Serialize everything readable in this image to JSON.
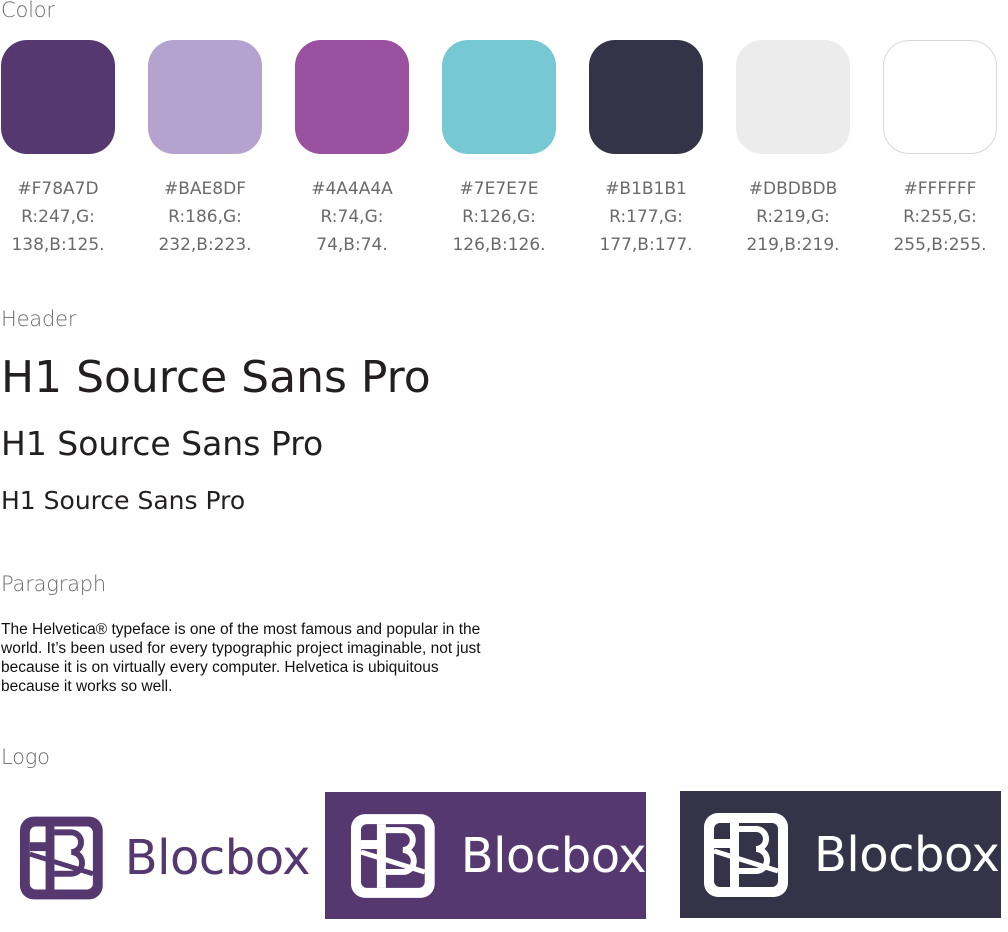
{
  "sections": {
    "color": "Color",
    "header": "Header",
    "paragraph": "Paragraph",
    "logo": "Logo"
  },
  "swatches": [
    {
      "fill": "#54386f",
      "hex": "#F78A7D",
      "rgb1": "R:247,G:",
      "rgb2": "138,B:125."
    },
    {
      "fill": "#b3a3ce",
      "hex": "#BAE8DF",
      "rgb1": "R:186,G:",
      "rgb2": "232,B:223."
    },
    {
      "fill": "#9a52a0",
      "hex": "#4A4A4A",
      "rgb1": "R:74,G:",
      "rgb2": "74,B:74."
    },
    {
      "fill": "#76c8d3",
      "hex": "#7E7E7E",
      "rgb1": "R:126,G:",
      "rgb2": "126,B:126."
    },
    {
      "fill": "#343348",
      "hex": "#B1B1B1",
      "rgb1": "R:177,G:",
      "rgb2": "177,B:177."
    },
    {
      "fill": "#ececec",
      "hex": "#DBDBDB",
      "rgb1": "R:219,G:",
      "rgb2": "219,B:219."
    },
    {
      "fill": "#ffffff",
      "hex": "#FFFFFF",
      "rgb1": "R:255,G:",
      "rgb2": "255,B:255."
    }
  ],
  "headers": {
    "h1": "H1 Source Sans Pro",
    "h2": "H1 Source Sans Pro",
    "h3": "H1 Source Sans Pro"
  },
  "paragraph_text": "The Helvetica® typeface is one of the most famous and popular in the world. It’s been used for every typographic project imaginable, not just because it is on virtually every computer. Helvetica is ubiquitous because it works so well.",
  "logos": [
    {
      "word": "Blocbox",
      "background": "#ffffff",
      "color": "#54386f"
    },
    {
      "word": "Blocbox",
      "background": "#54386f",
      "color": "#ffffff"
    },
    {
      "word": "Blocbox",
      "background": "#343348",
      "color": "#ffffff"
    }
  ]
}
